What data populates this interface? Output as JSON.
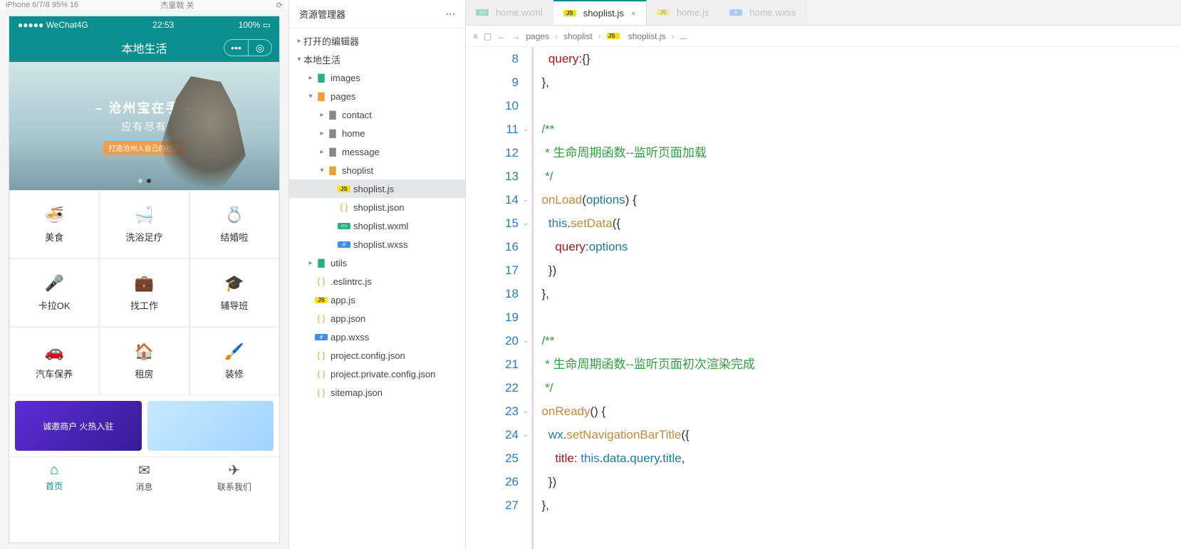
{
  "simulator": {
    "device_label": "iPhone 6/7/8 95% 16",
    "refresh_label": "杰童戟 关",
    "status": {
      "carrier": "●●●●● WeChat4G",
      "time": "22:53",
      "battery": "100%"
    },
    "nav_title": "本地生活",
    "hero": {
      "line1": "– 沧州宝在手 –",
      "line2": "应有尽有",
      "tag": "打造沧州人自己的社区"
    },
    "grid": [
      {
        "icon": "🍜",
        "label": "美食"
      },
      {
        "icon": "🛁",
        "label": "洗浴足疗"
      },
      {
        "icon": "💍",
        "label": "结婚啦"
      },
      {
        "icon": "🎤",
        "label": "卡拉OK"
      },
      {
        "icon": "💼",
        "label": "找工作"
      },
      {
        "icon": "🎓",
        "label": "辅导班"
      },
      {
        "icon": "🚗",
        "label": "汽车保养"
      },
      {
        "icon": "🏠",
        "label": "租房"
      },
      {
        "icon": "🖌️",
        "label": "装修"
      }
    ],
    "promos": [
      {
        "text": "诚邀商户 火热入驻"
      },
      {
        "text": ""
      }
    ],
    "tabs": [
      {
        "icon": "⌂",
        "label": "首页",
        "active": true
      },
      {
        "icon": "✉",
        "label": "消息",
        "active": false
      },
      {
        "icon": "✈",
        "label": "联系我们",
        "active": false
      }
    ]
  },
  "explorer": {
    "title": "资源管理器",
    "sections": {
      "opened": "打开的编辑器",
      "root": "本地生活"
    },
    "tree": [
      {
        "d": 1,
        "tw": "▸",
        "ic": "fold green",
        "name": "images"
      },
      {
        "d": 1,
        "tw": "▾",
        "ic": "fold",
        "name": "pages"
      },
      {
        "d": 2,
        "tw": "▸",
        "ic": "fold gray",
        "name": "contact"
      },
      {
        "d": 2,
        "tw": "▸",
        "ic": "fold gray",
        "name": "home"
      },
      {
        "d": 2,
        "tw": "▸",
        "ic": "fold gray",
        "name": "message"
      },
      {
        "d": 2,
        "tw": "▾",
        "ic": "fold",
        "name": "shoplist"
      },
      {
        "d": 3,
        "tw": "",
        "ic": "js",
        "name": "shoplist.js",
        "sel": true
      },
      {
        "d": 3,
        "tw": "",
        "ic": "json",
        "name": "shoplist.json"
      },
      {
        "d": 3,
        "tw": "",
        "ic": "wxml",
        "name": "shoplist.wxml"
      },
      {
        "d": 3,
        "tw": "",
        "ic": "wxss",
        "name": "shoplist.wxss"
      },
      {
        "d": 1,
        "tw": "▸",
        "ic": "fold green",
        "name": "utils"
      },
      {
        "d": 1,
        "tw": "",
        "ic": "json",
        "name": ".eslintrc.js",
        "iover": "⚙"
      },
      {
        "d": 1,
        "tw": "",
        "ic": "js",
        "name": "app.js"
      },
      {
        "d": 1,
        "tw": "",
        "ic": "json",
        "name": "app.json"
      },
      {
        "d": 1,
        "tw": "",
        "ic": "wxss",
        "name": "app.wxss"
      },
      {
        "d": 1,
        "tw": "",
        "ic": "json",
        "name": "project.config.json"
      },
      {
        "d": 1,
        "tw": "",
        "ic": "json",
        "name": "project.private.config.json"
      },
      {
        "d": 1,
        "tw": "",
        "ic": "json",
        "name": "sitemap.json"
      }
    ]
  },
  "editor": {
    "tabs": [
      {
        "label": "home.wxml",
        "ic": "wxml",
        "faded": true
      },
      {
        "label": "shoplist.js",
        "ic": "js",
        "active": true
      },
      {
        "label": "home.js",
        "ic": "js",
        "faded": true
      },
      {
        "label": "home.wxss",
        "ic": "wxss",
        "faded": true
      }
    ],
    "breadcrumb": [
      "pages",
      "shoplist",
      "shoplist.js",
      "..."
    ],
    "line_start": 8,
    "line_end": 27,
    "fold_marks": {
      "11": "⌄",
      "14": "⌄",
      "15": "⌄",
      "20": "⌄",
      "23": "⌄",
      "24": "⌄"
    },
    "code": {
      "l8": {
        "indent": 2,
        "tokens": [
          [
            "prop",
            "query"
          ],
          [
            "pun",
            ":"
          ],
          [
            "pun",
            "{}"
          ]
        ]
      },
      "l9": {
        "indent": 1,
        "tokens": [
          [
            "pun",
            "}"
          ],
          [
            "pun",
            ","
          ]
        ]
      },
      "l10": {
        "indent": 0,
        "tokens": []
      },
      "l11": {
        "indent": 1,
        "tokens": [
          [
            "com",
            "/**"
          ]
        ]
      },
      "l12": {
        "indent": 1,
        "tokens": [
          [
            "com",
            " * 生命周期函数--监听页面加载"
          ]
        ]
      },
      "l13": {
        "indent": 1,
        "tokens": [
          [
            "com",
            " */"
          ]
        ]
      },
      "l14": {
        "indent": 1,
        "tokens": [
          [
            "fn",
            "onLoad"
          ],
          [
            "pun",
            "("
          ],
          [
            "var",
            "options"
          ],
          [
            "pun",
            ")"
          ],
          [
            "pun",
            " {"
          ]
        ]
      },
      "l15": {
        "indent": 2,
        "tokens": [
          [
            "this",
            "this"
          ],
          [
            "pun",
            "."
          ],
          [
            "fn",
            "setData"
          ],
          [
            "pun",
            "({"
          ]
        ]
      },
      "l16": {
        "indent": 3,
        "tokens": [
          [
            "prop",
            "query"
          ],
          [
            "pun",
            ":"
          ],
          [
            "var",
            "options"
          ]
        ]
      },
      "l17": {
        "indent": 2,
        "tokens": [
          [
            "pun",
            "})"
          ]
        ]
      },
      "l18": {
        "indent": 1,
        "tokens": [
          [
            "pun",
            "}"
          ],
          [
            "pun",
            ","
          ]
        ]
      },
      "l19": {
        "indent": 0,
        "tokens": []
      },
      "l20": {
        "indent": 1,
        "tokens": [
          [
            "com",
            "/**"
          ]
        ]
      },
      "l21": {
        "indent": 1,
        "tokens": [
          [
            "com",
            " * 生命周期函数--监听页面初次渲染完成"
          ]
        ]
      },
      "l22": {
        "indent": 1,
        "tokens": [
          [
            "com",
            " */"
          ]
        ]
      },
      "l23": {
        "indent": 1,
        "tokens": [
          [
            "fn",
            "onReady"
          ],
          [
            "pun",
            "()"
          ],
          [
            "pun",
            " {"
          ]
        ]
      },
      "l24": {
        "indent": 2,
        "tokens": [
          [
            "var",
            "wx"
          ],
          [
            "pun",
            "."
          ],
          [
            "fn",
            "setNavigationBarTitle"
          ],
          [
            "pun",
            "({"
          ]
        ]
      },
      "l25": {
        "indent": 3,
        "tokens": [
          [
            "prop",
            "title"
          ],
          [
            "pun",
            ": "
          ],
          [
            "this",
            "this"
          ],
          [
            "pun",
            "."
          ],
          [
            "var",
            "data"
          ],
          [
            "pun",
            "."
          ],
          [
            "var",
            "query"
          ],
          [
            "pun",
            "."
          ],
          [
            "var",
            "title"
          ],
          [
            "pun",
            ","
          ]
        ]
      },
      "l26": {
        "indent": 2,
        "tokens": [
          [
            "pun",
            "})"
          ]
        ]
      },
      "l27": {
        "indent": 1,
        "tokens": [
          [
            "pun",
            "}"
          ],
          [
            "pun",
            ","
          ]
        ]
      }
    }
  }
}
